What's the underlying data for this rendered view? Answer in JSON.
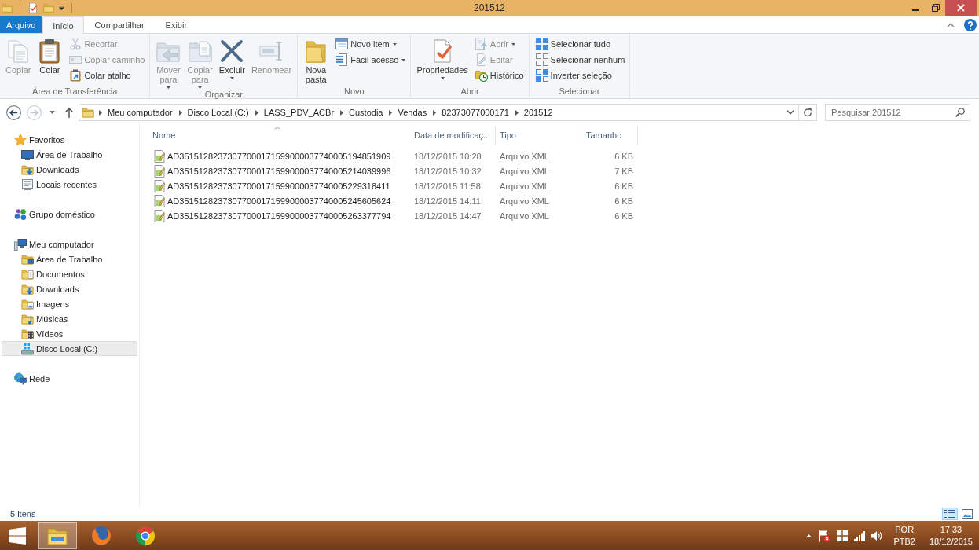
{
  "window": {
    "title": "201512"
  },
  "ribbon_tabs": [
    {
      "label": "Arquivo",
      "kind": "menu",
      "selected": false
    },
    {
      "label": "Início",
      "kind": "tab",
      "selected": true
    },
    {
      "label": "Compartilhar",
      "kind": "tab",
      "selected": false
    },
    {
      "label": "Exibir",
      "kind": "tab",
      "selected": false
    }
  ],
  "ribbon_groups": [
    {
      "label": "Área de Transferência",
      "large": [
        {
          "label": "Copiar",
          "kind": "copy",
          "disabled": true,
          "dropdown": false
        },
        {
          "label": "Colar",
          "kind": "paste",
          "disabled": false,
          "dropdown": false
        }
      ],
      "small": [
        {
          "label": "Recortar",
          "kind": "cut",
          "disabled": true,
          "dropdown": false
        },
        {
          "label": "Copiar caminho",
          "kind": "path",
          "disabled": true,
          "dropdown": false
        },
        {
          "label": "Colar atalho",
          "kind": "shortcut",
          "disabled": false,
          "dropdown": false
        }
      ]
    },
    {
      "label": "Organizar",
      "large": [
        {
          "label": "Mover para",
          "kind": "move",
          "disabled": true,
          "dropdown": true
        },
        {
          "label": "Copiar para",
          "kind": "copyto",
          "disabled": true,
          "dropdown": true
        },
        {
          "label": "Excluir",
          "kind": "delete",
          "disabled": false,
          "dropdown": true
        },
        {
          "label": "Renomear",
          "kind": "rename",
          "disabled": true,
          "dropdown": false
        }
      ]
    },
    {
      "label": "Novo",
      "large": [
        {
          "label": "Nova pasta",
          "kind": "newfolder",
          "disabled": false,
          "dropdown": false
        }
      ],
      "small": [
        {
          "label": "Novo item",
          "kind": "newitem",
          "disabled": false,
          "dropdown": true
        },
        {
          "label": "Fácil acesso",
          "kind": "easyaccess",
          "disabled": false,
          "dropdown": true
        }
      ]
    },
    {
      "label": "Abrir",
      "large": [
        {
          "label": "Propriedades",
          "kind": "properties",
          "disabled": false,
          "dropdown": true
        }
      ],
      "small": [
        {
          "label": "Abrir",
          "kind": "open",
          "disabled": true,
          "dropdown": true
        },
        {
          "label": "Editar",
          "kind": "edit",
          "disabled": true,
          "dropdown": false
        },
        {
          "label": "Histórico",
          "kind": "history",
          "disabled": false,
          "dropdown": false
        }
      ]
    },
    {
      "label": "Selecionar",
      "small": [
        {
          "label": "Selecionar tudo",
          "kind": "selectall",
          "disabled": false,
          "dropdown": false
        },
        {
          "label": "Selecionar nenhum",
          "kind": "selectnone",
          "disabled": false,
          "dropdown": false
        },
        {
          "label": "Inverter seleção",
          "kind": "invert",
          "disabled": false,
          "dropdown": false
        }
      ]
    }
  ],
  "address": {
    "crumbs": [
      "Meu computador",
      "Disco Local (C:)",
      "LASS_PDV_ACBr",
      "Custodia",
      "Vendas",
      "82373077000171",
      "201512"
    ]
  },
  "search": {
    "placeholder": "Pesquisar 201512"
  },
  "navigation": [
    {
      "label": "Favoritos",
      "kind": "favorites",
      "selected": false,
      "children": [
        {
          "label": "Área de Trabalho",
          "kind": "desktop",
          "selected": false
        },
        {
          "label": "Downloads",
          "kind": "downloads",
          "selected": false
        },
        {
          "label": "Locais recentes",
          "kind": "recent",
          "selected": false
        }
      ]
    },
    {
      "label": "Grupo doméstico",
      "kind": "homegroup",
      "selected": false
    },
    {
      "label": "Meu computador",
      "kind": "computer",
      "selected": false,
      "children": [
        {
          "label": "Área de Trabalho",
          "kind": "desktopfolder",
          "selected": false
        },
        {
          "label": "Documentos",
          "kind": "documents",
          "selected": false
        },
        {
          "label": "Downloads",
          "kind": "downloads",
          "selected": false
        },
        {
          "label": "Imagens",
          "kind": "images",
          "selected": false
        },
        {
          "label": "Músicas",
          "kind": "music",
          "selected": false
        },
        {
          "label": "Vídeos",
          "kind": "videos",
          "selected": false
        },
        {
          "label": "Disco Local (C:)",
          "kind": "drive",
          "selected": true
        }
      ]
    },
    {
      "label": "Rede",
      "kind": "network",
      "selected": false
    }
  ],
  "columns": [
    {
      "label": "Nome",
      "sorted": true
    },
    {
      "label": "Data de modificaç...",
      "sorted": false
    },
    {
      "label": "Tipo",
      "sorted": false
    },
    {
      "label": "Tamanho",
      "sorted": false
    }
  ],
  "files": [
    {
      "name": "AD35151282373077000171599000037740005194851909",
      "modified": "18/12/2015 10:28",
      "type": "Arquivo XML",
      "size": "6 KB"
    },
    {
      "name": "AD35151282373077000171599000037740005214039996",
      "modified": "18/12/2015 10:32",
      "type": "Arquivo XML",
      "size": "7 KB"
    },
    {
      "name": "AD35151282373077000171599000037740005229318411",
      "modified": "18/12/2015 11:58",
      "type": "Arquivo XML",
      "size": "6 KB"
    },
    {
      "name": "AD35151282373077000171599000037740005245605624",
      "modified": "18/12/2015 14:11",
      "type": "Arquivo XML",
      "size": "6 KB"
    },
    {
      "name": "AD35151282373077000171599000037740005263377794",
      "modified": "18/12/2015 14:47",
      "type": "Arquivo XML",
      "size": "6 KB"
    }
  ],
  "status_bar": {
    "item_count": "5 itens",
    "views": [
      {
        "kind": "details",
        "selected": true
      },
      {
        "kind": "icons",
        "selected": false
      }
    ]
  },
  "taskbar": {
    "apps": [
      {
        "kind": "explorer",
        "selected": true
      },
      {
        "kind": "firefox",
        "selected": false
      },
      {
        "kind": "chrome",
        "selected": false
      }
    ],
    "tray": {
      "language": "POR",
      "keyboard": "PTB2",
      "time": "17:33",
      "date": "18/12/2015"
    }
  }
}
